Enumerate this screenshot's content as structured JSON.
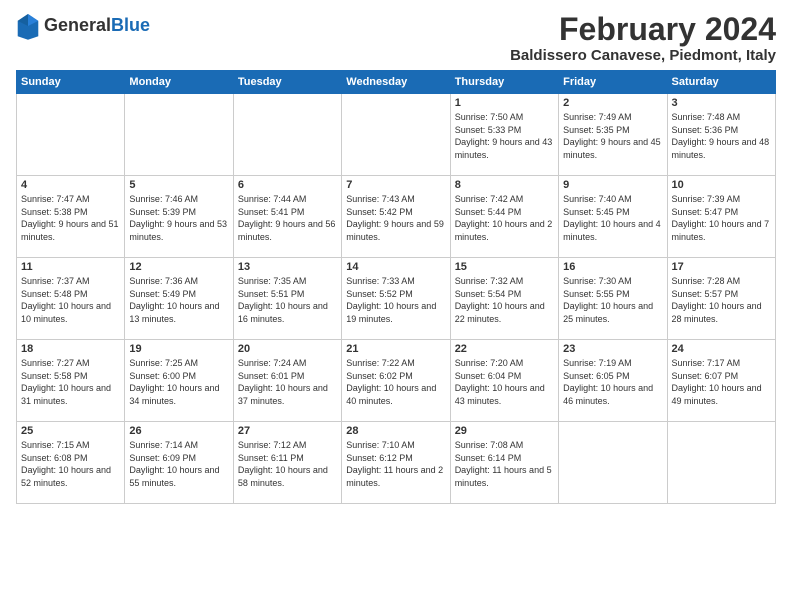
{
  "logo": {
    "general": "General",
    "blue": "Blue"
  },
  "header": {
    "month": "February 2024",
    "location": "Baldissero Canavese, Piedmont, Italy"
  },
  "weekdays": [
    "Sunday",
    "Monday",
    "Tuesday",
    "Wednesday",
    "Thursday",
    "Friday",
    "Saturday"
  ],
  "weeks": [
    [
      {
        "day": "",
        "info": ""
      },
      {
        "day": "",
        "info": ""
      },
      {
        "day": "",
        "info": ""
      },
      {
        "day": "",
        "info": ""
      },
      {
        "day": "1",
        "info": "Sunrise: 7:50 AM\nSunset: 5:33 PM\nDaylight: 9 hours\nand 43 minutes."
      },
      {
        "day": "2",
        "info": "Sunrise: 7:49 AM\nSunset: 5:35 PM\nDaylight: 9 hours\nand 45 minutes."
      },
      {
        "day": "3",
        "info": "Sunrise: 7:48 AM\nSunset: 5:36 PM\nDaylight: 9 hours\nand 48 minutes."
      }
    ],
    [
      {
        "day": "4",
        "info": "Sunrise: 7:47 AM\nSunset: 5:38 PM\nDaylight: 9 hours\nand 51 minutes."
      },
      {
        "day": "5",
        "info": "Sunrise: 7:46 AM\nSunset: 5:39 PM\nDaylight: 9 hours\nand 53 minutes."
      },
      {
        "day": "6",
        "info": "Sunrise: 7:44 AM\nSunset: 5:41 PM\nDaylight: 9 hours\nand 56 minutes."
      },
      {
        "day": "7",
        "info": "Sunrise: 7:43 AM\nSunset: 5:42 PM\nDaylight: 9 hours\nand 59 minutes."
      },
      {
        "day": "8",
        "info": "Sunrise: 7:42 AM\nSunset: 5:44 PM\nDaylight: 10 hours\nand 2 minutes."
      },
      {
        "day": "9",
        "info": "Sunrise: 7:40 AM\nSunset: 5:45 PM\nDaylight: 10 hours\nand 4 minutes."
      },
      {
        "day": "10",
        "info": "Sunrise: 7:39 AM\nSunset: 5:47 PM\nDaylight: 10 hours\nand 7 minutes."
      }
    ],
    [
      {
        "day": "11",
        "info": "Sunrise: 7:37 AM\nSunset: 5:48 PM\nDaylight: 10 hours\nand 10 minutes."
      },
      {
        "day": "12",
        "info": "Sunrise: 7:36 AM\nSunset: 5:49 PM\nDaylight: 10 hours\nand 13 minutes."
      },
      {
        "day": "13",
        "info": "Sunrise: 7:35 AM\nSunset: 5:51 PM\nDaylight: 10 hours\nand 16 minutes."
      },
      {
        "day": "14",
        "info": "Sunrise: 7:33 AM\nSunset: 5:52 PM\nDaylight: 10 hours\nand 19 minutes."
      },
      {
        "day": "15",
        "info": "Sunrise: 7:32 AM\nSunset: 5:54 PM\nDaylight: 10 hours\nand 22 minutes."
      },
      {
        "day": "16",
        "info": "Sunrise: 7:30 AM\nSunset: 5:55 PM\nDaylight: 10 hours\nand 25 minutes."
      },
      {
        "day": "17",
        "info": "Sunrise: 7:28 AM\nSunset: 5:57 PM\nDaylight: 10 hours\nand 28 minutes."
      }
    ],
    [
      {
        "day": "18",
        "info": "Sunrise: 7:27 AM\nSunset: 5:58 PM\nDaylight: 10 hours\nand 31 minutes."
      },
      {
        "day": "19",
        "info": "Sunrise: 7:25 AM\nSunset: 6:00 PM\nDaylight: 10 hours\nand 34 minutes."
      },
      {
        "day": "20",
        "info": "Sunrise: 7:24 AM\nSunset: 6:01 PM\nDaylight: 10 hours\nand 37 minutes."
      },
      {
        "day": "21",
        "info": "Sunrise: 7:22 AM\nSunset: 6:02 PM\nDaylight: 10 hours\nand 40 minutes."
      },
      {
        "day": "22",
        "info": "Sunrise: 7:20 AM\nSunset: 6:04 PM\nDaylight: 10 hours\nand 43 minutes."
      },
      {
        "day": "23",
        "info": "Sunrise: 7:19 AM\nSunset: 6:05 PM\nDaylight: 10 hours\nand 46 minutes."
      },
      {
        "day": "24",
        "info": "Sunrise: 7:17 AM\nSunset: 6:07 PM\nDaylight: 10 hours\nand 49 minutes."
      }
    ],
    [
      {
        "day": "25",
        "info": "Sunrise: 7:15 AM\nSunset: 6:08 PM\nDaylight: 10 hours\nand 52 minutes."
      },
      {
        "day": "26",
        "info": "Sunrise: 7:14 AM\nSunset: 6:09 PM\nDaylight: 10 hours\nand 55 minutes."
      },
      {
        "day": "27",
        "info": "Sunrise: 7:12 AM\nSunset: 6:11 PM\nDaylight: 10 hours\nand 58 minutes."
      },
      {
        "day": "28",
        "info": "Sunrise: 7:10 AM\nSunset: 6:12 PM\nDaylight: 11 hours\nand 2 minutes."
      },
      {
        "day": "29",
        "info": "Sunrise: 7:08 AM\nSunset: 6:14 PM\nDaylight: 11 hours\nand 5 minutes."
      },
      {
        "day": "",
        "info": ""
      },
      {
        "day": "",
        "info": ""
      }
    ]
  ]
}
